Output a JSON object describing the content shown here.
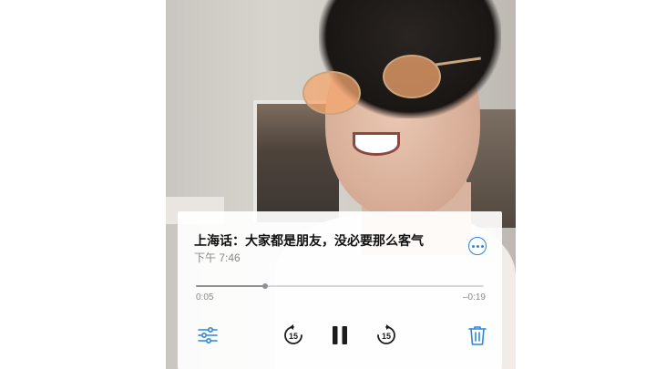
{
  "recording": {
    "title": "上海话：大家都是朋友，没必要那么客气",
    "timestamp": "下午 7:46"
  },
  "playback": {
    "elapsed": "0:05",
    "remaining": "–0:19",
    "progress_fraction": 0.24
  },
  "controls": {
    "skip_back_seconds": "15",
    "skip_forward_seconds": "15"
  },
  "colors": {
    "accent": "#2d86d9",
    "track": "#d8d8dc",
    "track_fill": "#8e8e93",
    "text_primary": "#111111",
    "text_secondary": "#8a8a8e"
  },
  "icons": {
    "more": "more-icon",
    "equalizer": "sliders-icon",
    "skip_back": "skip-back-15-icon",
    "pause": "pause-icon",
    "skip_forward": "skip-forward-15-icon",
    "delete": "trash-icon"
  }
}
